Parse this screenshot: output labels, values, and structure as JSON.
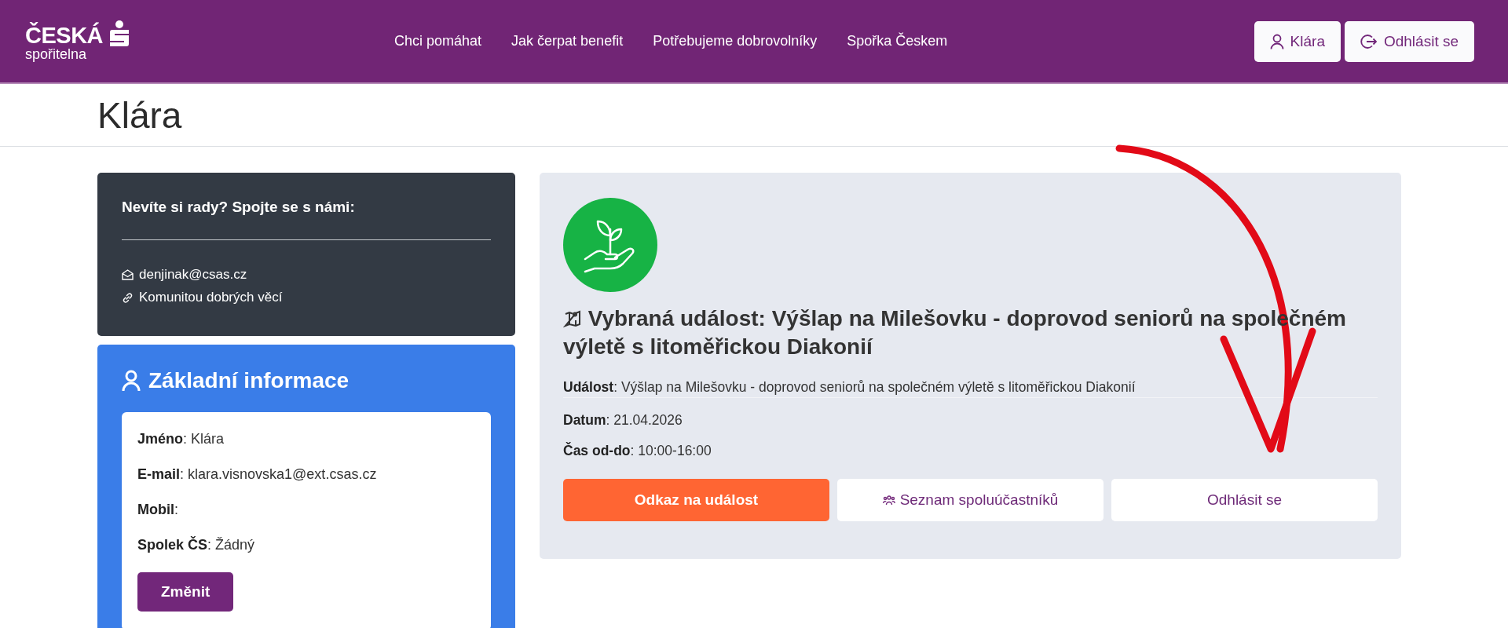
{
  "header": {
    "logo": {
      "brand": "ČESKÁ",
      "sub": "spořitelna"
    },
    "nav": [
      {
        "label": "Chci pomáhat"
      },
      {
        "label": "Jak čerpat benefit"
      },
      {
        "label": "Potřebujeme dobrovolníky"
      },
      {
        "label": "Spořka Českem"
      }
    ],
    "user_button": "Klára",
    "logout_button": "Odhlásit se"
  },
  "page_title": "Klára",
  "contact_card": {
    "title": "Nevíte si rady? Spojte se s námi:",
    "email": "denjinak@csas.cz",
    "link": "Komunitou dobrých věcí"
  },
  "info_card": {
    "title": "Základní informace",
    "fields": [
      "**Jméno**: Klára",
      "**E-mail**: klara.visnovska1@ext.csas.cz",
      "**Mobil**:",
      "**Spolek ČS**: Žádný"
    ],
    "button": "Změnit"
  },
  "event": {
    "title": "Vybraná událost: Výšlap na Milešovku - doprovod seniorů na společném výletě s litoměřickou Diakonií",
    "details": [
      "**Událost**: Výšlap na Milešovku - doprovod seniorů na společném výletě s litoměřickou Diakonií",
      "**Datum**: 21.04.2026",
      "**Čas od-do**: 10:00-16:00"
    ],
    "buttons": [
      {
        "label": "Odkaz na událost",
        "kind": "primary"
      },
      {
        "label": "Seznam spoluúčastníků",
        "kind": "participants"
      },
      {
        "label": "Odhlásit se",
        "kind": "plain"
      }
    ]
  }
}
